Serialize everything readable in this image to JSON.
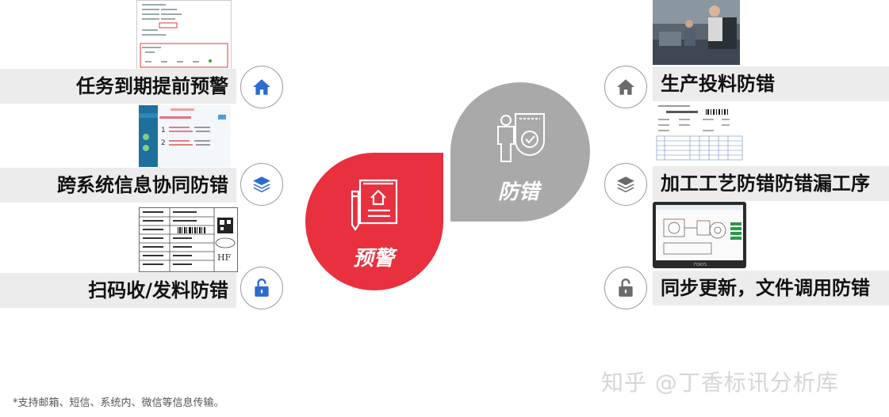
{
  "left_items": [
    {
      "label": "任务到期提前预警",
      "icon": "home-icon"
    },
    {
      "label": "跨系统信息协同防错",
      "icon": "layers-icon"
    },
    {
      "label": "扫码收/发料防错",
      "icon": "unlock-icon"
    }
  ],
  "right_items": [
    {
      "label": "生产投料防错",
      "icon": "home-icon"
    },
    {
      "label": "加工工艺防错防错漏工序",
      "icon": "layers-icon"
    },
    {
      "label": "同步更新，文件调用防错",
      "icon": "unlock-icon"
    }
  ],
  "center": {
    "warning_label": "预警",
    "proofing_label": "防错",
    "warning_color": "#e8303f",
    "proofing_color": "#a9a9a9"
  },
  "footnote": "*支持邮箱、短信、系统内、微信等信息传输。",
  "watermark": "知乎 @丁香标讯分析库",
  "thumbnails": {
    "barcode_tag_text": "HF",
    "machine_brand": "FORYS"
  }
}
